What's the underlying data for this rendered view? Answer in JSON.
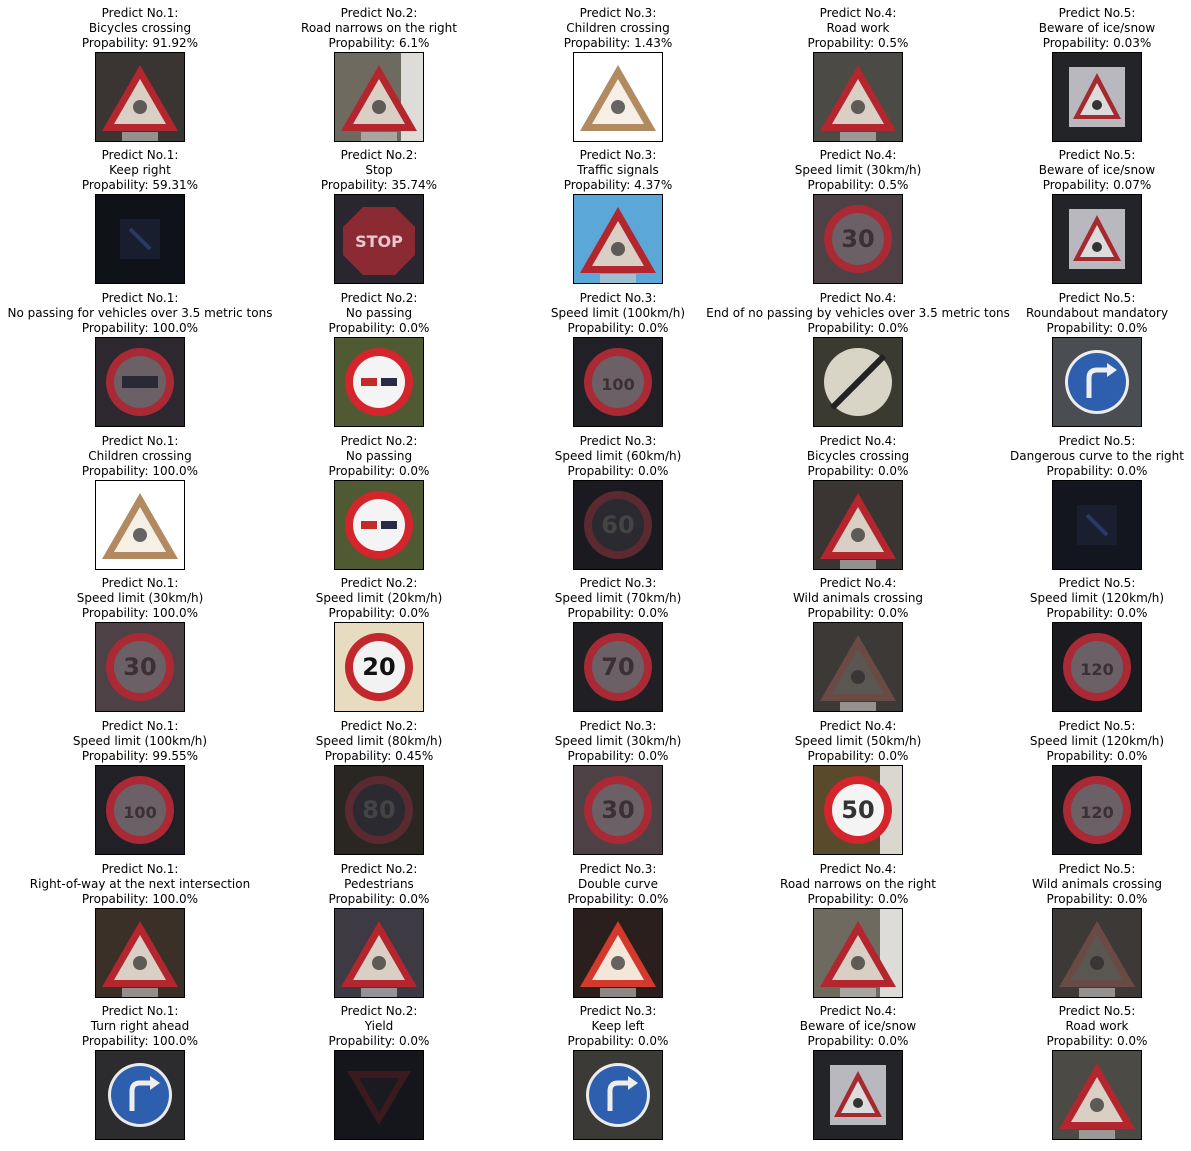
{
  "rows": [
    [
      {
        "rank": "Predict No.1:",
        "label": "Bicycles crossing",
        "prob": "Propability: 91.92%",
        "sign": "triangle",
        "bg": "#3a3532",
        "symbol": "bike-icon"
      },
      {
        "rank": "Predict No.2:",
        "label": "Road narrows on the right",
        "prob": "Propability: 6.1%",
        "sign": "triangle",
        "bg": "#6f6a60",
        "symbol": "narrow-icon",
        "glare": true
      },
      {
        "rank": "Predict No.3:",
        "label": "Children crossing",
        "prob": "Propability: 1.43%",
        "sign": "triangle-light",
        "bg": "#ffffff",
        "symbol": "children-icon"
      },
      {
        "rank": "Predict No.4:",
        "label": "Road work",
        "prob": "Propability: 0.5%",
        "sign": "triangle",
        "bg": "#4b4a44",
        "symbol": "worker-icon"
      },
      {
        "rank": "Predict No.5:",
        "label": "Beware of ice/snow",
        "prob": "Propability: 0.03%",
        "sign": "square-triangle",
        "bg": "#232427",
        "symbol": "snowflake-icon"
      }
    ],
    [
      {
        "rank": "Predict No.1:",
        "label": "Keep right",
        "prob": "Propability: 59.31%",
        "sign": "dark",
        "bg": "#10121a",
        "symbol": "arrow-icon"
      },
      {
        "rank": "Predict No.2:",
        "label": "Stop",
        "prob": "Propability: 35.74%",
        "sign": "octagon",
        "bg": "#2a2630",
        "symbol": "stop-icon",
        "text": "STOP"
      },
      {
        "rank": "Predict No.3:",
        "label": "Traffic signals",
        "prob": "Propability: 4.37%",
        "sign": "triangle",
        "bg": "#5aa7d8",
        "symbol": "traffic-light-icon"
      },
      {
        "rank": "Predict No.4:",
        "label": "Speed limit (30km/h)",
        "prob": "Propability: 0.5%",
        "sign": "circle",
        "bg": "#4d4145",
        "symbol": "speed-30-icon",
        "text": "30"
      },
      {
        "rank": "Predict No.5:",
        "label": "Beware of ice/snow",
        "prob": "Propability: 0.07%",
        "sign": "square-triangle",
        "bg": "#232427",
        "symbol": "snowflake-icon"
      }
    ],
    [
      {
        "rank": "Predict No.1:",
        "label": "No passing for vehicles over 3.5 metric tons",
        "prob": "Propability: 100.0%",
        "sign": "circle",
        "bg": "#2d2730",
        "symbol": "truck-icon"
      },
      {
        "rank": "Predict No.2:",
        "label": "No passing",
        "prob": "Propability: 0.0%",
        "sign": "circle-bright",
        "bg": "#4f5a33",
        "symbol": "no-passing-icon"
      },
      {
        "rank": "Predict No.3:",
        "label": "Speed limit (100km/h)",
        "prob": "Propability: 0.0%",
        "sign": "circle",
        "bg": "#212026",
        "symbol": "speed-100-icon",
        "text": "100"
      },
      {
        "rank": "Predict No.4:",
        "label": "End of no passing by vehicles over 3.5 metric tons",
        "prob": "Propability: 0.0%",
        "sign": "end-circle",
        "bg": "#3a3a31",
        "symbol": "end-restriction-icon"
      },
      {
        "rank": "Predict No.5:",
        "label": "Roundabout mandatory",
        "prob": "Propability: 0.0%",
        "sign": "blue-circle",
        "bg": "#4a4d52",
        "symbol": "roundabout-icon"
      }
    ],
    [
      {
        "rank": "Predict No.1:",
        "label": "Children crossing",
        "prob": "Propability: 100.0%",
        "sign": "triangle-light",
        "bg": "#ffffff",
        "symbol": "children-icon"
      },
      {
        "rank": "Predict No.2:",
        "label": "No passing",
        "prob": "Propability: 0.0%",
        "sign": "circle-bright",
        "bg": "#4f5a33",
        "symbol": "no-passing-icon"
      },
      {
        "rank": "Predict No.3:",
        "label": "Speed limit (60km/h)",
        "prob": "Propability: 0.0%",
        "sign": "circle-dark",
        "bg": "#1a1a20",
        "symbol": "speed-60-icon",
        "text": "60"
      },
      {
        "rank": "Predict No.4:",
        "label": "Bicycles crossing",
        "prob": "Propability: 0.0%",
        "sign": "triangle",
        "bg": "#3a3532",
        "symbol": "bike-icon"
      },
      {
        "rank": "Predict No.5:",
        "label": "Dangerous curve to the right",
        "prob": "Propability: 0.0%",
        "sign": "dark",
        "bg": "#14161f",
        "symbol": "curve-icon"
      }
    ],
    [
      {
        "rank": "Predict No.1:",
        "label": "Speed limit (30km/h)",
        "prob": "Propability: 100.0%",
        "sign": "circle",
        "bg": "#4d4145",
        "symbol": "speed-30-icon",
        "text": "30"
      },
      {
        "rank": "Predict No.2:",
        "label": "Speed limit (20km/h)",
        "prob": "Propability: 0.0%",
        "sign": "circle-light",
        "bg": "#e8dcc0",
        "symbol": "speed-20-icon",
        "text": "20"
      },
      {
        "rank": "Predict No.3:",
        "label": "Speed limit (70km/h)",
        "prob": "Propability: 0.0%",
        "sign": "circle",
        "bg": "#1f1f24",
        "symbol": "speed-70-icon",
        "text": "70"
      },
      {
        "rank": "Predict No.4:",
        "label": "Wild animals crossing",
        "prob": "Propability: 0.0%",
        "sign": "triangle-dim",
        "bg": "#3c3936",
        "symbol": "deer-icon"
      },
      {
        "rank": "Predict No.5:",
        "label": "Speed limit (120km/h)",
        "prob": "Propability: 0.0%",
        "sign": "circle",
        "bg": "#1a1a1f",
        "symbol": "speed-120-icon",
        "text": "120"
      }
    ],
    [
      {
        "rank": "Predict No.1:",
        "label": "Speed limit (100km/h)",
        "prob": "Propability: 99.55%",
        "sign": "circle",
        "bg": "#212026",
        "symbol": "speed-100-icon",
        "text": "100"
      },
      {
        "rank": "Predict No.2:",
        "label": "Speed limit (80km/h)",
        "prob": "Propability: 0.45%",
        "sign": "circle-dark",
        "bg": "#2a2622",
        "symbol": "speed-80-icon",
        "text": "80"
      },
      {
        "rank": "Predict No.3:",
        "label": "Speed limit (30km/h)",
        "prob": "Propability: 0.0%",
        "sign": "circle",
        "bg": "#4d4145",
        "symbol": "speed-30-icon",
        "text": "30"
      },
      {
        "rank": "Predict No.4:",
        "label": "Speed limit (50km/h)",
        "prob": "Propability: 0.0%",
        "sign": "circle-bright",
        "bg": "#5a4a2c",
        "symbol": "speed-50-icon",
        "text": "50",
        "glare": true
      },
      {
        "rank": "Predict No.5:",
        "label": "Speed limit (120km/h)",
        "prob": "Propability: 0.0%",
        "sign": "circle",
        "bg": "#1a1a1f",
        "symbol": "speed-120-icon",
        "text": "120"
      }
    ],
    [
      {
        "rank": "Predict No.1:",
        "label": "Right-of-way at the next intersection",
        "prob": "Propability: 100.0%",
        "sign": "triangle",
        "bg": "#3b3028",
        "symbol": "intersection-icon"
      },
      {
        "rank": "Predict No.2:",
        "label": "Pedestrians",
        "prob": "Propability: 0.0%",
        "sign": "triangle",
        "bg": "#3d3a44",
        "symbol": "pedestrian-icon"
      },
      {
        "rank": "Predict No.3:",
        "label": "Double curve",
        "prob": "Propability: 0.0%",
        "sign": "triangle-bright",
        "bg": "#2a1f1d",
        "symbol": "double-curve-icon"
      },
      {
        "rank": "Predict No.4:",
        "label": "Road narrows on the right",
        "prob": "Propability: 0.0%",
        "sign": "triangle",
        "bg": "#6f6a60",
        "symbol": "narrow-icon",
        "glare": true
      },
      {
        "rank": "Predict No.5:",
        "label": "Wild animals crossing",
        "prob": "Propability: 0.0%",
        "sign": "triangle-dim",
        "bg": "#3c3936",
        "symbol": "deer-icon"
      }
    ],
    [
      {
        "rank": "Predict No.1:",
        "label": "Turn right ahead",
        "prob": "Propability: 100.0%",
        "sign": "blue-circle",
        "bg": "#2c2b2e",
        "symbol": "turn-right-icon"
      },
      {
        "rank": "Predict No.2:",
        "label": "Yield",
        "prob": "Propability: 0.0%",
        "sign": "yield",
        "bg": "#15161c",
        "symbol": "yield-icon"
      },
      {
        "rank": "Predict No.3:",
        "label": "Keep left",
        "prob": "Propability: 0.0%",
        "sign": "blue-circle",
        "bg": "#3c3a36",
        "symbol": "keep-left-icon"
      },
      {
        "rank": "Predict No.4:",
        "label": "Beware of ice/snow",
        "prob": "Propability: 0.0%",
        "sign": "square-triangle",
        "bg": "#232427",
        "symbol": "snowflake-icon"
      },
      {
        "rank": "Predict No.5:",
        "label": "Road work",
        "prob": "Propability: 0.0%",
        "sign": "triangle",
        "bg": "#4b4a44",
        "symbol": "worker-icon"
      }
    ]
  ]
}
